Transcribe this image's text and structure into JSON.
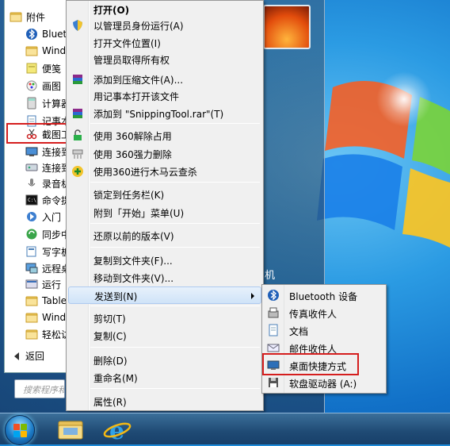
{
  "start_menu": {
    "programs": [
      {
        "label": "附件",
        "icon": "folder-icon",
        "indent": false
      },
      {
        "label": "Bluetooth",
        "icon": "bluetooth-icon",
        "indent": true
      },
      {
        "label": "Windows",
        "icon": "folder-icon",
        "indent": true
      },
      {
        "label": "便笺",
        "icon": "sticky-notes-icon",
        "indent": true
      },
      {
        "label": "画图",
        "icon": "paint-icon",
        "indent": true
      },
      {
        "label": "计算器",
        "icon": "calculator-icon",
        "indent": true
      },
      {
        "label": "记事本",
        "icon": "notepad-icon",
        "indent": true
      },
      {
        "label": "截图工具",
        "icon": "snipping-tool-icon",
        "indent": true
      },
      {
        "label": "连接到投影仪",
        "icon": "projector-icon",
        "indent": true
      },
      {
        "label": "连接到网络",
        "icon": "network-icon",
        "indent": true
      },
      {
        "label": "录音机",
        "icon": "microphone-icon",
        "indent": true
      },
      {
        "label": "命令提示符",
        "icon": "cmd-icon",
        "indent": true
      },
      {
        "label": "入门",
        "icon": "getting-started-icon",
        "indent": true
      },
      {
        "label": "同步中心",
        "icon": "sync-icon",
        "indent": true
      },
      {
        "label": "写字板",
        "icon": "wordpad-icon",
        "indent": true
      },
      {
        "label": "远程桌面连接",
        "icon": "remote-desktop-icon",
        "indent": true
      },
      {
        "label": "运行",
        "icon": "run-icon",
        "indent": true
      },
      {
        "label": "Tablet PC",
        "icon": "folder-icon",
        "indent": true
      },
      {
        "label": "Windows",
        "icon": "folder-icon",
        "indent": true
      },
      {
        "label": "轻松访问",
        "icon": "folder-icon",
        "indent": true
      }
    ],
    "back_label": "返回",
    "search_placeholder": "搜索程序和文件",
    "machine_label": "机"
  },
  "context_menu": {
    "items": [
      {
        "label": "打开(O)",
        "bold": true,
        "icon": ""
      },
      {
        "label": "以管理员身份运行(A)",
        "icon": "uac-shield-icon"
      },
      {
        "label": "打开文件位置(I)",
        "icon": ""
      },
      {
        "label": "管理员取得所有权",
        "icon": ""
      },
      {
        "label": "添加到压缩文件(A)...",
        "icon": "winrar-icon"
      },
      {
        "label": "用记事本打开该文件",
        "icon": ""
      },
      {
        "label": "添加到 \"SnippingTool.rar\"(T)",
        "icon": "winrar-icon"
      },
      {
        "label": "使用 360解除占用",
        "icon": "360-unlock-icon"
      },
      {
        "label": "使用 360强力删除",
        "icon": "360-shred-icon"
      },
      {
        "label": "使用360进行木马云查杀",
        "icon": "360-scan-icon"
      },
      {
        "label": "锁定到任务栏(K)",
        "icon": ""
      },
      {
        "label": "附到「开始」菜单(U)",
        "icon": ""
      },
      {
        "label": "还原以前的版本(V)",
        "icon": ""
      },
      {
        "label": "复制到文件夹(F)...",
        "icon": ""
      },
      {
        "label": "移动到文件夹(V)...",
        "icon": ""
      },
      {
        "label": "发送到(N)",
        "icon": "",
        "submenu": true
      },
      {
        "label": "剪切(T)",
        "icon": ""
      },
      {
        "label": "复制(C)",
        "icon": ""
      },
      {
        "label": "删除(D)",
        "icon": ""
      },
      {
        "label": "重命名(M)",
        "icon": ""
      },
      {
        "label": "属性(R)",
        "icon": ""
      }
    ]
  },
  "send_to_menu": {
    "items": [
      {
        "label": "Bluetooth 设备",
        "icon": "bluetooth-icon"
      },
      {
        "label": "传真收件人",
        "icon": "fax-icon"
      },
      {
        "label": "文档",
        "icon": "documents-icon"
      },
      {
        "label": "邮件收件人",
        "icon": "mail-icon"
      },
      {
        "label": "桌面快捷方式",
        "icon": "desktop-icon"
      },
      {
        "label": "软盘驱动器 (A:)",
        "icon": "floppy-icon"
      }
    ]
  },
  "taskbar": {
    "items": [
      {
        "name": "start-button",
        "icon": "windows-logo-icon"
      },
      {
        "name": "explorer-button",
        "icon": "folder-icon"
      },
      {
        "name": "internet-explorer-button",
        "icon": "ie-icon"
      }
    ]
  },
  "colors": {
    "highlight": "#cfe3f8",
    "annotation": "#d51e1e"
  }
}
